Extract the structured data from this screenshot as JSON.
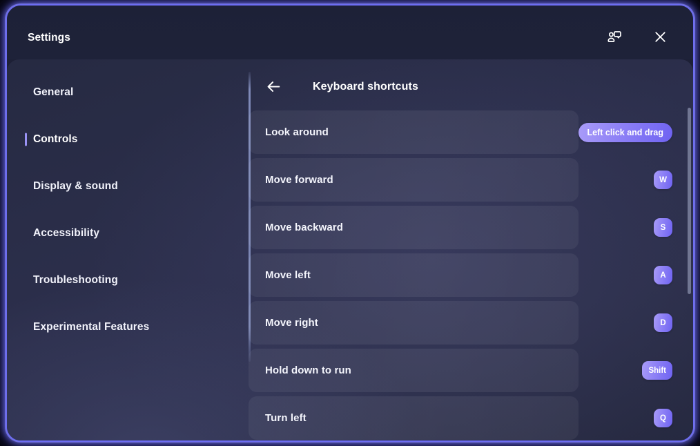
{
  "window": {
    "title": "Settings",
    "border_color": "#6d6df2",
    "background_color": "#2a2d47"
  },
  "titlebar": {
    "feedback_icon": "person-speech-bubble-icon",
    "close_icon": "close-icon"
  },
  "sidebar": {
    "items": [
      {
        "label": "General",
        "active": false
      },
      {
        "label": "Controls",
        "active": true
      },
      {
        "label": "Display & sound",
        "active": false
      },
      {
        "label": "Accessibility",
        "active": false
      },
      {
        "label": "Troubleshooting",
        "active": false
      },
      {
        "label": "Experimental Features",
        "active": false
      }
    ],
    "active_indicator_color": "#9a93f5"
  },
  "panel": {
    "back_icon": "arrow-left-icon",
    "title": "Keyboard shortcuts",
    "key_badge_color": "#8f82f6",
    "shortcuts": [
      {
        "action": "Look around",
        "key": "Left click and drag",
        "key_style": "pill"
      },
      {
        "action": "Move forward",
        "key": "W",
        "key_style": "square"
      },
      {
        "action": "Move backward",
        "key": "S",
        "key_style": "square"
      },
      {
        "action": "Move left",
        "key": "A",
        "key_style": "square"
      },
      {
        "action": "Move right",
        "key": "D",
        "key_style": "square"
      },
      {
        "action": "Hold down to run",
        "key": "Shift",
        "key_style": "wide"
      },
      {
        "action": "Turn left",
        "key": "Q",
        "key_style": "square"
      }
    ]
  },
  "scrollbar": {
    "orientation": "vertical",
    "thumb_color": "#b4bcd7"
  }
}
